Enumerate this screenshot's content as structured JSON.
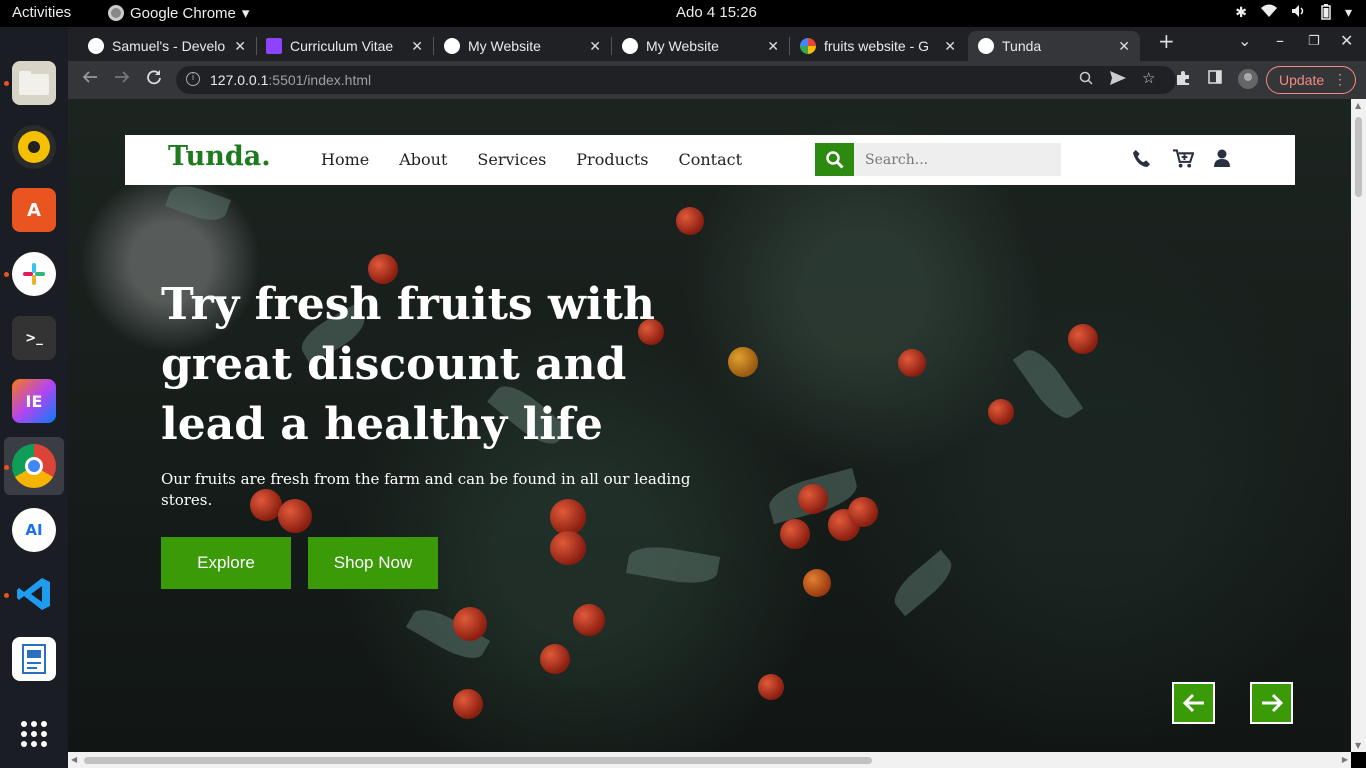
{
  "system": {
    "activities": "Activities",
    "app_name": "Google Chrome",
    "clock": "Ado 4  15:26"
  },
  "browser": {
    "tabs": [
      {
        "title": "Samuel's - Develo",
        "favicon_color": "#ffffff"
      },
      {
        "title": "Curriculum Vitae",
        "favicon_color": "#8e44ff"
      },
      {
        "title": "My Website",
        "favicon_color": "#ffffff"
      },
      {
        "title": "My Website",
        "favicon_color": "#ffffff"
      },
      {
        "title": "fruits website - G",
        "favicon_color": "#4285f4"
      },
      {
        "title": "Tunda",
        "favicon_color": "#ffffff"
      }
    ],
    "active_tab_index": 5,
    "url_host": "127.0.0.1",
    "url_rest": ":5501/index.html",
    "update_label": "Update",
    "update_color": "#f28b82"
  },
  "site": {
    "logo": "Tunda.",
    "brand_color": "#1e7a1e",
    "accent_color": "#3a9a08",
    "menu": [
      "Home",
      "About",
      "Services",
      "Products",
      "Contact"
    ],
    "search_placeholder": "Search...",
    "icons": [
      "phone-icon",
      "cart-icon",
      "user-icon"
    ]
  },
  "hero": {
    "title": "Try fresh fruits with great discount and lead a healthy life",
    "subtitle": "Our fruits are fresh from the farm and can be found in all our leading stores.",
    "primary_button": "Explore",
    "secondary_button": "Shop Now"
  },
  "slider": {
    "prev_icon": "arrow-left-icon",
    "next_icon": "arrow-right-icon"
  }
}
